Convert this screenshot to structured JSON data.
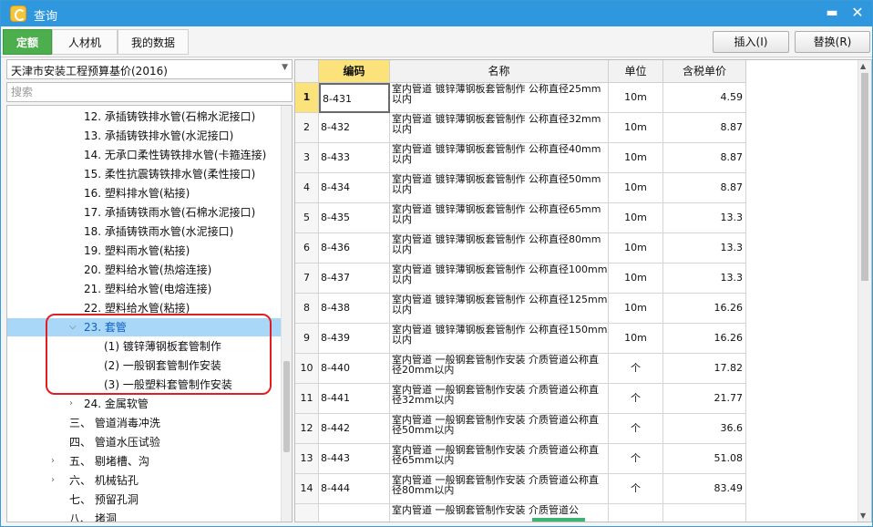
{
  "window": {
    "title": "查询"
  },
  "tabs": [
    {
      "label": "定额",
      "active": true
    },
    {
      "label": "人材机",
      "active": false
    },
    {
      "label": "我的数据",
      "active": false
    }
  ],
  "actions": {
    "insert": "插入(I)",
    "replace": "替换(R)"
  },
  "left": {
    "dropdown_value": "天津市安装工程预算基价(2016)",
    "search_placeholder": "搜索",
    "tree": [
      {
        "text": "12.  承插铸铁排水管(石棉水泥接口)",
        "level": 2
      },
      {
        "text": "13.  承插铸铁排水管(水泥接口)",
        "level": 2
      },
      {
        "text": "14.  无承口柔性铸铁排水管(卡箍连接)",
        "level": 2
      },
      {
        "text": "15.  柔性抗震铸铁排水管(柔性接口)",
        "level": 2
      },
      {
        "text": "16.  塑料排水管(粘接)",
        "level": 2
      },
      {
        "text": "17.  承插铸铁雨水管(石棉水泥接口)",
        "level": 2
      },
      {
        "text": "18.  承插铸铁雨水管(水泥接口)",
        "level": 2
      },
      {
        "text": "19.  塑料雨水管(粘接)",
        "level": 2
      },
      {
        "text": "20.  塑料给水管(热熔连接)",
        "level": 2
      },
      {
        "text": "21.  塑料给水管(电熔连接)",
        "level": 2
      },
      {
        "text": "22.  塑料给水管(粘接)",
        "level": 2
      },
      {
        "text": "23.  套管",
        "level": 2,
        "expander": "expanded",
        "selected": true
      },
      {
        "text": "(1) 镀锌薄钢板套管制作",
        "level": 3
      },
      {
        "text": "(2) 一般钢套管制作安装",
        "level": 3
      },
      {
        "text": "(3) 一般塑料套管制作安装",
        "level": 3
      },
      {
        "text": "24.  金属软管",
        "level": 2,
        "expander": "collapsed"
      },
      {
        "text": "三、  管道消毒冲洗",
        "level": 1
      },
      {
        "text": "四、  管道水压试验",
        "level": 1
      },
      {
        "text": "五、  剔堵槽、沟",
        "level": 1,
        "expander": "collapsed"
      },
      {
        "text": "六、  机械钻孔",
        "level": 1,
        "expander": "collapsed"
      },
      {
        "text": "七、  预留孔洞",
        "level": 1
      },
      {
        "text": "八、  堵洞",
        "level": 1
      }
    ]
  },
  "grid": {
    "headers": {
      "code": "编码",
      "name": "名称",
      "unit": "单位",
      "price": "含税单价"
    },
    "rows": [
      {
        "no": "1",
        "code": "8-431",
        "name": "室内管道 镀锌薄钢板套管制作 公称直径25mm以内",
        "unit": "10m",
        "price": "4.59"
      },
      {
        "no": "2",
        "code": "8-432",
        "name": "室内管道 镀锌薄钢板套管制作 公称直径32mm以内",
        "unit": "10m",
        "price": "8.87"
      },
      {
        "no": "3",
        "code": "8-433",
        "name": "室内管道 镀锌薄钢板套管制作 公称直径40mm以内",
        "unit": "10m",
        "price": "8.87"
      },
      {
        "no": "4",
        "code": "8-434",
        "name": "室内管道 镀锌薄钢板套管制作 公称直径50mm以内",
        "unit": "10m",
        "price": "8.87"
      },
      {
        "no": "5",
        "code": "8-435",
        "name": "室内管道 镀锌薄钢板套管制作 公称直径65mm以内",
        "unit": "10m",
        "price": "13.3"
      },
      {
        "no": "6",
        "code": "8-436",
        "name": "室内管道 镀锌薄钢板套管制作 公称直径80mm以内",
        "unit": "10m",
        "price": "13.3"
      },
      {
        "no": "7",
        "code": "8-437",
        "name": "室内管道 镀锌薄钢板套管制作 公称直径100mm以内",
        "unit": "10m",
        "price": "13.3"
      },
      {
        "no": "8",
        "code": "8-438",
        "name": "室内管道 镀锌薄钢板套管制作 公称直径125mm以内",
        "unit": "10m",
        "price": "16.26"
      },
      {
        "no": "9",
        "code": "8-439",
        "name": "室内管道 镀锌薄钢板套管制作 公称直径150mm以内",
        "unit": "10m",
        "price": "16.26"
      },
      {
        "no": "10",
        "code": "8-440",
        "name": "室内管道 一般钢套管制作安装 介质管道公称直径20mm以内",
        "unit": "个",
        "price": "17.82"
      },
      {
        "no": "11",
        "code": "8-441",
        "name": "室内管道 一般钢套管制作安装 介质管道公称直径32mm以内",
        "unit": "个",
        "price": "21.77"
      },
      {
        "no": "12",
        "code": "8-442",
        "name": "室内管道 一般钢套管制作安装 介质管道公称直径50mm以内",
        "unit": "个",
        "price": "36.6"
      },
      {
        "no": "13",
        "code": "8-443",
        "name": "室内管道 一般钢套管制作安装 介质管道公称直径65mm以内",
        "unit": "个",
        "price": "51.08"
      },
      {
        "no": "14",
        "code": "8-444",
        "name": "室内管道 一般钢套管制作安装 介质管道公称直径80mm以内",
        "unit": "个",
        "price": "83.49"
      },
      {
        "no": "",
        "code": "",
        "name": "室内管道 一般钢套管制作安装 介质管道公",
        "unit": "",
        "price": ""
      }
    ]
  }
}
